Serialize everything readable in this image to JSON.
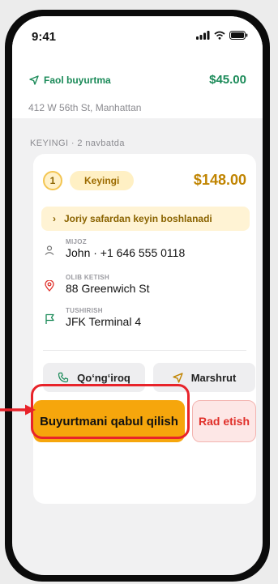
{
  "status_bar": {
    "time": "9:41"
  },
  "active_order": {
    "title": "Faol buyurtma",
    "price": "$45.00",
    "address": "412 W 56th St, Manhattan"
  },
  "queue": {
    "section_label": "KEYINGI · 2 navbatda",
    "position": "1",
    "status_pill": "Keyingi",
    "price": "$148.00",
    "notice": "Joriy safardan keyin boshlanadi",
    "customer": {
      "label": "MIJOZ",
      "value": "John · +1 646 555 0118"
    },
    "pickup": {
      "label": "OLIB KETISH",
      "value": "88 Greenwich St"
    },
    "dropoff": {
      "label": "TUSHIRISH",
      "value": "JFK Terminal 4"
    },
    "call_label": "Qo‘ng‘iroq",
    "route_label": "Marshrut",
    "accept_label": "Buyurtmani qabul qilish",
    "reject_label": "Rad etish"
  },
  "colors": {
    "accent_green": "#1a8a58",
    "accent_amber": "#f6a60c",
    "danger_red": "#e0302a",
    "highlight_red": "#e8232a"
  }
}
